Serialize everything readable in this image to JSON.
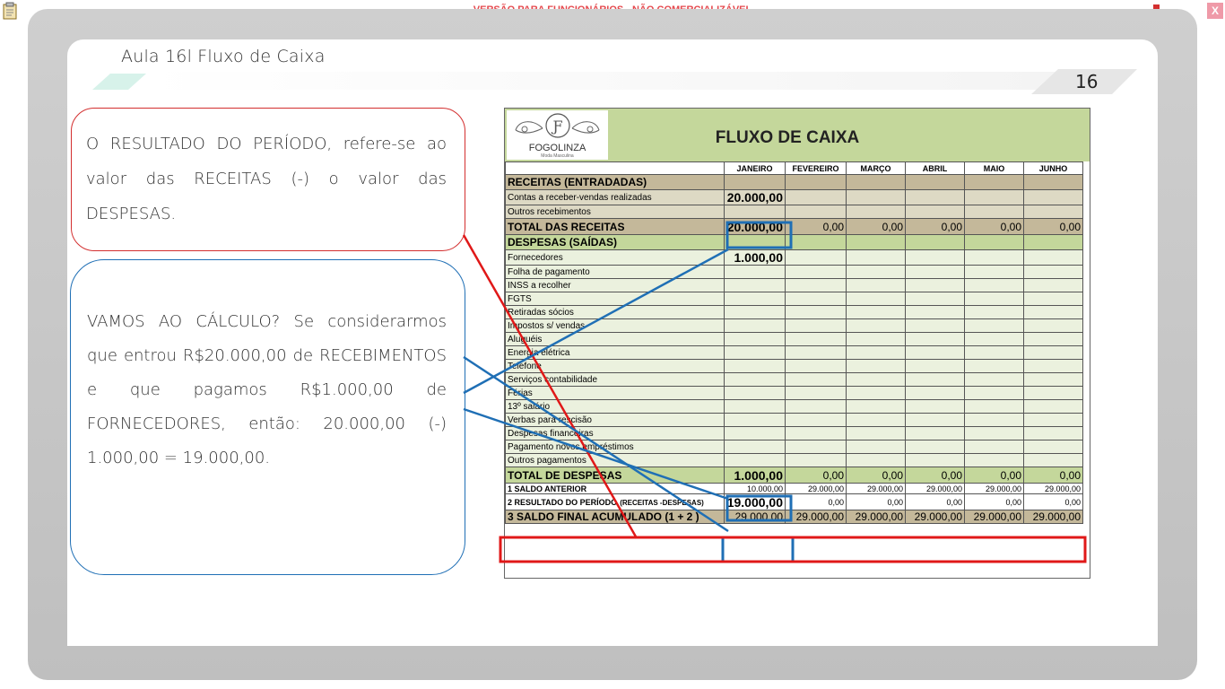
{
  "top_banner": "VERSÃO PARA FUNCIONÁRIOS - NÃO COMERCIALIZÁVEL",
  "close_label": "X",
  "lesson_title": "Aula 16l Fluxo de Caixa",
  "page_number": "16",
  "callout_red": "O RESULTADO DO PERÍODO, refere-se ao valor das RECEITAS (-) o valor das DESPESAS.",
  "callout_blue": "VAMOS AO CÁLCULO? Se considerarmos que entrou R$20.000,00 de RECEBIMENTOS e que pagamos R$1.000,00 de FORNECEDORES, então: 20.000,00 (-) 1.000,00 = 19.000,00.",
  "sheet": {
    "logo_name": "FOGOLINZA",
    "logo_sub": "Moda Masculina",
    "title": "FLUXO DE CAIXA",
    "months": [
      "JANEIRO",
      "FEVEREIRO",
      "MARÇO",
      "ABRIL",
      "MAIO",
      "JUNHO"
    ],
    "receitas_header": "RECEITAS (ENTRADADAS)",
    "receitas_rows": [
      {
        "label": "Contas a receber-vendas realizadas",
        "janeiro": "20.000,00"
      },
      {
        "label": "Outros recebimentos",
        "janeiro": ""
      }
    ],
    "total_receitas": {
      "label": "TOTAL DAS RECEITAS",
      "values": [
        "20.000,00",
        "0,00",
        "0,00",
        "0,00",
        "0,00",
        "0,00"
      ]
    },
    "despesas_header": "DESPESAS (SAÍDAS)",
    "despesas_rows": [
      {
        "label": "Fornecedores",
        "janeiro": "1.000,00"
      },
      {
        "label": "Folha de pagamento",
        "janeiro": ""
      },
      {
        "label": "INSS a recolher",
        "janeiro": ""
      },
      {
        "label": "FGTS",
        "janeiro": ""
      },
      {
        "label": "Retiradas sócios",
        "janeiro": ""
      },
      {
        "label": "Impostos s/ vendas",
        "janeiro": ""
      },
      {
        "label": "Aluguéis",
        "janeiro": ""
      },
      {
        "label": "Energia elétrica",
        "janeiro": ""
      },
      {
        "label": "Telefone",
        "janeiro": ""
      },
      {
        "label": "Serviços contabilidade",
        "janeiro": ""
      },
      {
        "label": "Férias",
        "janeiro": ""
      },
      {
        "label": "13º salário",
        "janeiro": ""
      },
      {
        "label": "Verbas para rescisão",
        "janeiro": ""
      },
      {
        "label": "Despesas financeiras",
        "janeiro": ""
      },
      {
        "label": "Pagamento novos empréstimos",
        "janeiro": ""
      },
      {
        "label": "Outros pagamentos",
        "janeiro": ""
      }
    ],
    "total_despesas": {
      "label": "TOTAL DE DESPESAS",
      "values": [
        "1.000,00",
        "0,00",
        "0,00",
        "0,00",
        "0,00",
        "0,00"
      ]
    },
    "saldo_anterior": {
      "label": "1 SALDO ANTERIOR",
      "values": [
        "10.000,00",
        "29.000,00",
        "29.000,00",
        "29.000,00",
        "29.000,00",
        "29.000,00"
      ]
    },
    "resultado": {
      "label": "2 RESULTADO DO PERÍODO",
      "label_suffix": "(RECEITAS -DESPESAS)",
      "values": [
        "19.000,00",
        "0,00",
        "0,00",
        "0,00",
        "0,00",
        "0,00"
      ]
    },
    "saldo_final": {
      "label": "3 SALDO FINAL ACUMULADO (1 + 2 )",
      "values": [
        "29.000,00",
        "29.000,00",
        "29.000,00",
        "29.000,00",
        "29.000,00",
        "29.000,00"
      ]
    }
  },
  "colors": {
    "banner_red": "#e5484d",
    "callout_red": "#d32f2f",
    "callout_blue": "#1f6fb5",
    "sheet_green": "#c4d79b",
    "sheet_tan": "#c4b89a"
  }
}
